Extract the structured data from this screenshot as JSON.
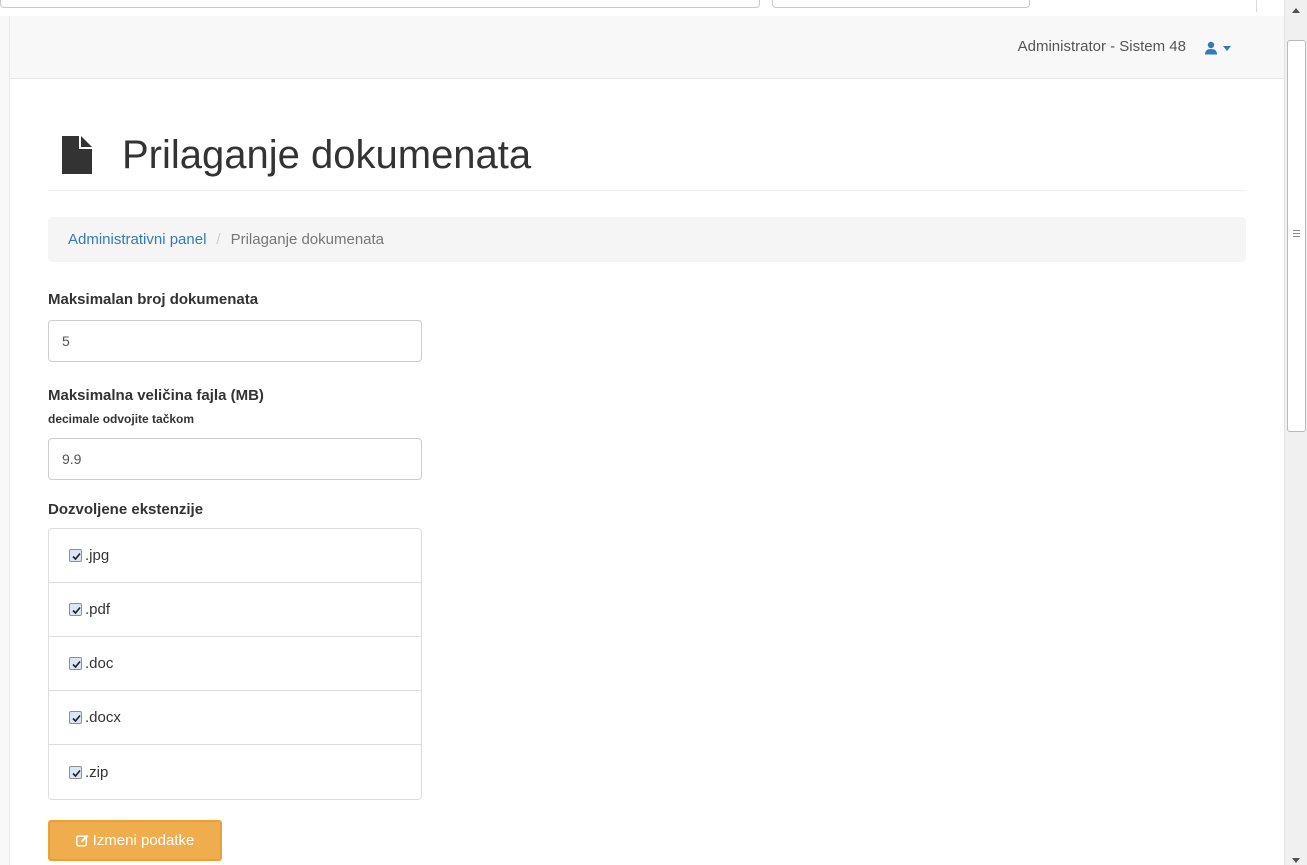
{
  "navbar": {
    "user_label": "Administrator - Sistem 48",
    "user_icon": "user-icon",
    "accent": "#337ab7"
  },
  "page": {
    "title": "Prilaganje dokumenata",
    "title_icon": "file-icon"
  },
  "breadcrumb": {
    "items": [
      {
        "label": "Administrativni panel"
      },
      {
        "label": "Prilaganje dokumenata"
      }
    ],
    "separator": "/"
  },
  "form": {
    "max_documents": {
      "label": "Maksimalan broj dokumenata",
      "value": "5"
    },
    "max_file_size": {
      "label": "Maksimalna veličina fajla (MB)",
      "help": "decimale odvojite tačkom",
      "value": "9.9"
    },
    "extensions": {
      "label": "Dozvoljene ekstenzije",
      "items": [
        {
          "label": ".jpg",
          "checked": true
        },
        {
          "label": ".pdf",
          "checked": true
        },
        {
          "label": ".doc",
          "checked": true
        },
        {
          "label": ".docx",
          "checked": true
        },
        {
          "label": ".zip",
          "checked": true
        }
      ]
    },
    "submit": {
      "label": "Izmeni podatke",
      "icon": "edit-icon",
      "color": "#f0ad4e"
    }
  }
}
